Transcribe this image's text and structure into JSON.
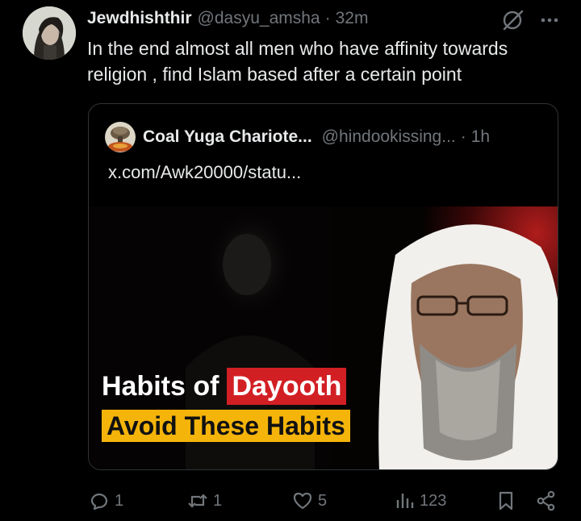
{
  "tweet": {
    "author_name": "Jewdhishthir",
    "handle": "@dasyu_amsha",
    "separator": "·",
    "time": "32m",
    "text": "In the end almost all men who have affinity towards religion , find Islam based after a certain point"
  },
  "quote": {
    "author_name": "Coal Yuga Chariote...",
    "handle": "@hindookissing...",
    "separator": "·",
    "time": "1h",
    "link_text": "x.com/Awk20000/statu...",
    "media": {
      "title_plain": "Habits of",
      "title_highlight": "Dayooth",
      "subtitle": "Avoid These Habits",
      "colors": {
        "highlight_red": "#d21f24",
        "subtitle_yellow": "#f5b40a"
      }
    }
  },
  "actions": {
    "reply_count": "1",
    "repost_count": "1",
    "like_count": "5",
    "views_count": "123"
  },
  "colors": {
    "background": "#000000",
    "text": "#e7e9ea",
    "muted": "#71767b",
    "border": "#2f3336"
  },
  "icons": [
    "grok-icon",
    "more-icon",
    "reply-icon",
    "repost-icon",
    "like-icon",
    "views-icon",
    "bookmark-icon",
    "share-icon"
  ]
}
